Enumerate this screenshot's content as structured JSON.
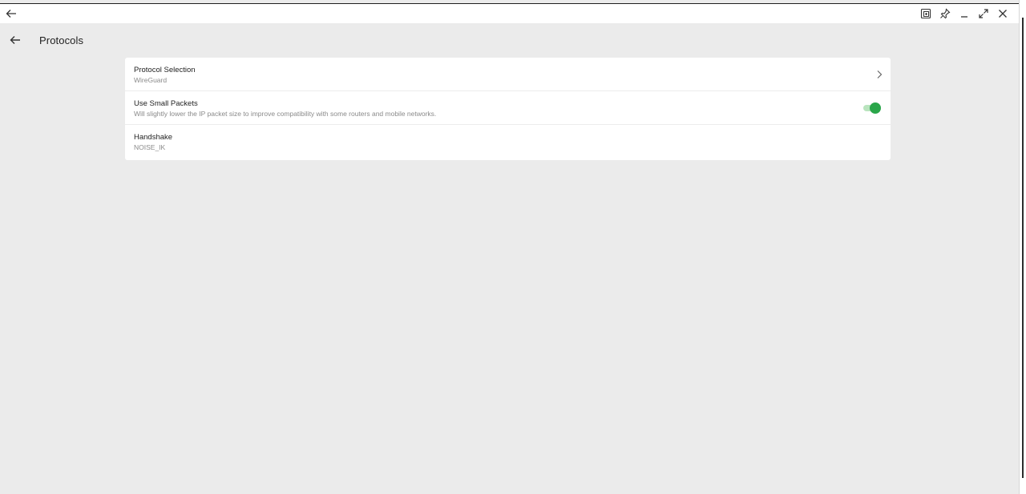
{
  "caption": {
    "back_icon": "arrow-left-icon",
    "tools": [
      {
        "name": "snap-icon"
      },
      {
        "name": "pin-icon"
      },
      {
        "name": "minimize-icon"
      },
      {
        "name": "maximize-icon"
      },
      {
        "name": "close-icon"
      }
    ]
  },
  "appbar": {
    "title": "Protocols"
  },
  "settings": [
    {
      "title": "Protocol Selection",
      "subtitle": "WireGuard",
      "control": "chevron"
    },
    {
      "title": "Use Small Packets",
      "subtitle": "Will slightly lower the IP packet size to improve compatibility with some routers and mobile networks.",
      "control": "toggle",
      "checked": true
    },
    {
      "title": "Handshake",
      "subtitle": "NOISE_IK",
      "control": "none"
    }
  ],
  "colors": {
    "accent": "#2aa64a",
    "background": "#ebebeb",
    "card": "#ffffff"
  }
}
